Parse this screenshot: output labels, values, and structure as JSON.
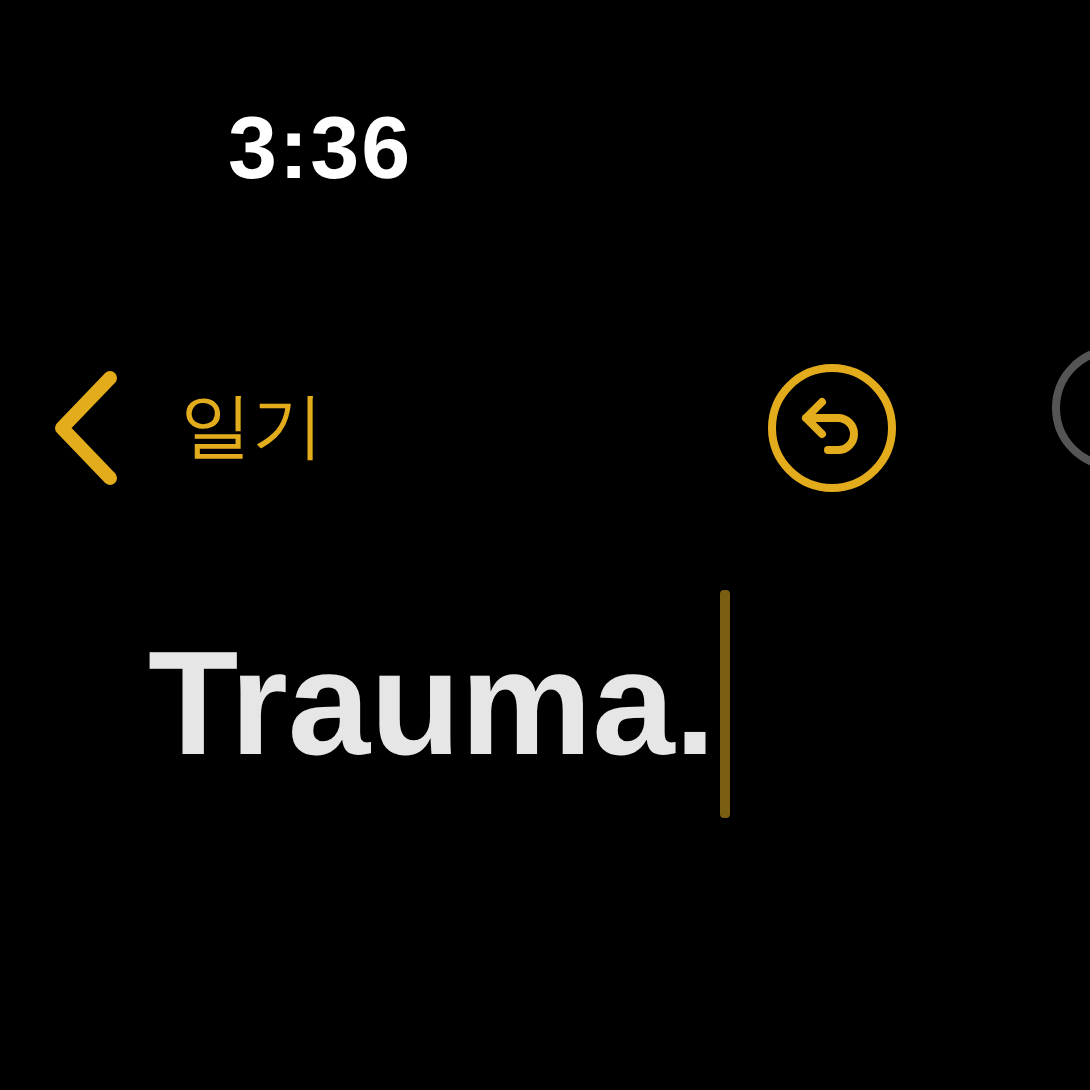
{
  "status_bar": {
    "time": "3:36"
  },
  "nav": {
    "back_label": "일기"
  },
  "note": {
    "title": "Trauma."
  }
}
